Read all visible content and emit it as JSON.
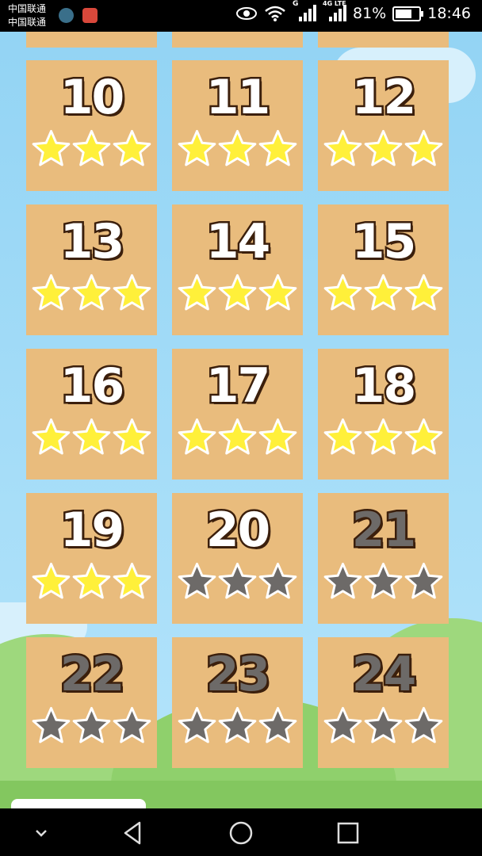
{
  "status_bar": {
    "carrier_1": "中国联通",
    "carrier_2": "中国联通",
    "signal_1_label": "G",
    "signal_2_label": "4G LTE",
    "battery_text": "81%",
    "battery_level": 0.81,
    "time": "18:46",
    "icons": [
      "app-icon-1",
      "app-icon-2",
      "eye-icon",
      "wifi-icon",
      "signal-icon",
      "signal-icon",
      "battery-icon"
    ]
  },
  "colors": {
    "tile": "#e9bc7d",
    "star_earned": "#fff03a",
    "star_empty": "#6d6a68",
    "number_outline": "#3b1f0c",
    "sky": "#9fd8f5"
  },
  "levels": [
    {
      "number": "10",
      "stars": 3,
      "locked": false
    },
    {
      "number": "11",
      "stars": 3,
      "locked": false
    },
    {
      "number": "12",
      "stars": 3,
      "locked": false
    },
    {
      "number": "13",
      "stars": 3,
      "locked": false
    },
    {
      "number": "14",
      "stars": 3,
      "locked": false
    },
    {
      "number": "15",
      "stars": 3,
      "locked": false
    },
    {
      "number": "16",
      "stars": 3,
      "locked": false
    },
    {
      "number": "17",
      "stars": 3,
      "locked": false
    },
    {
      "number": "18",
      "stars": 3,
      "locked": false
    },
    {
      "number": "19",
      "stars": 3,
      "locked": false
    },
    {
      "number": "20",
      "stars": 0,
      "locked": false
    },
    {
      "number": "21",
      "stars": 0,
      "locked": true
    },
    {
      "number": "22",
      "stars": 0,
      "locked": true
    },
    {
      "number": "23",
      "stars": 0,
      "locked": true
    },
    {
      "number": "24",
      "stars": 0,
      "locked": true
    }
  ],
  "nav_bar": {
    "buttons": [
      "chevron-down-icon",
      "back-icon",
      "home-icon",
      "recents-icon"
    ]
  }
}
